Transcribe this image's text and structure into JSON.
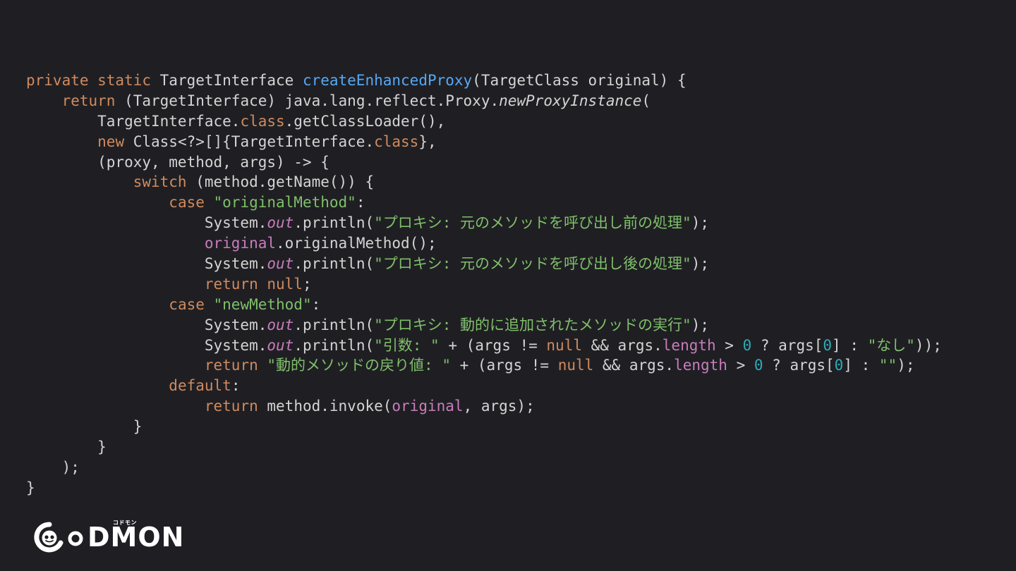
{
  "code": {
    "language": "java",
    "colors": {
      "background": "#1f1f23",
      "plain": "#d4d4d4",
      "keyword": "#d08a5e",
      "method_declaration": "#56a8f5",
      "string": "#7fbf6a",
      "field": "#c77dbb",
      "number": "#2aacb8"
    },
    "lines": [
      [
        [
          "keyword",
          "private static "
        ],
        [
          "plain",
          "TargetInterface "
        ],
        [
          "method-decl",
          "createEnhancedProxy"
        ],
        [
          "plain",
          "(TargetClass original) {"
        ]
      ],
      [
        [
          "plain",
          "    "
        ],
        [
          "keyword",
          "return "
        ],
        [
          "plain",
          "(TargetInterface) java.lang.reflect.Proxy."
        ],
        [
          "italic",
          "newProxyInstance"
        ],
        [
          "plain",
          "("
        ]
      ],
      [
        [
          "plain",
          "        TargetInterface."
        ],
        [
          "keyword",
          "class"
        ],
        [
          "plain",
          ".getClassLoader(),"
        ]
      ],
      [
        [
          "plain",
          "        "
        ],
        [
          "keyword",
          "new "
        ],
        [
          "plain",
          "Class<?>[]{TargetInterface."
        ],
        [
          "keyword",
          "class"
        ],
        [
          "plain",
          "},"
        ]
      ],
      [
        [
          "plain",
          "        (proxy, method, args) -> {"
        ]
      ],
      [
        [
          "plain",
          "            "
        ],
        [
          "keyword",
          "switch "
        ],
        [
          "plain",
          "(method.getName()) {"
        ]
      ],
      [
        [
          "plain",
          "                "
        ],
        [
          "keyword",
          "case "
        ],
        [
          "string",
          "\"originalMethod\""
        ],
        [
          "plain",
          ":"
        ]
      ],
      [
        [
          "plain",
          "                    System."
        ],
        [
          "field",
          "out"
        ],
        [
          "plain",
          ".println("
        ],
        [
          "string",
          "\"プロキシ: 元のメソッドを呼び出し前の処理\""
        ],
        [
          "plain",
          ");"
        ]
      ],
      [
        [
          "plain",
          "                    "
        ],
        [
          "var",
          "original"
        ],
        [
          "plain",
          ".originalMethod();"
        ]
      ],
      [
        [
          "plain",
          "                    System."
        ],
        [
          "field",
          "out"
        ],
        [
          "plain",
          ".println("
        ],
        [
          "string",
          "\"プロキシ: 元のメソッドを呼び出し後の処理\""
        ],
        [
          "plain",
          ");"
        ]
      ],
      [
        [
          "plain",
          "                    "
        ],
        [
          "keyword",
          "return null"
        ],
        [
          "plain",
          ";"
        ]
      ],
      [
        [
          "plain",
          "                "
        ],
        [
          "keyword",
          "case "
        ],
        [
          "string",
          "\"newMethod\""
        ],
        [
          "plain",
          ":"
        ]
      ],
      [
        [
          "plain",
          "                    System."
        ],
        [
          "field",
          "out"
        ],
        [
          "plain",
          ".println("
        ],
        [
          "string",
          "\"プロキシ: 動的に追加されたメソッドの実行\""
        ],
        [
          "plain",
          ");"
        ]
      ],
      [
        [
          "plain",
          "                    System."
        ],
        [
          "field",
          "out"
        ],
        [
          "plain",
          ".println("
        ],
        [
          "string",
          "\"引数: \""
        ],
        [
          "plain",
          " + (args != "
        ],
        [
          "keyword",
          "null"
        ],
        [
          "plain",
          " && args."
        ],
        [
          "var",
          "length"
        ],
        [
          "plain",
          " > "
        ],
        [
          "number",
          "0"
        ],
        [
          "plain",
          " ? args["
        ],
        [
          "number",
          "0"
        ],
        [
          "plain",
          "] : "
        ],
        [
          "string",
          "\"なし\""
        ],
        [
          "plain",
          "));"
        ]
      ],
      [
        [
          "plain",
          "                    "
        ],
        [
          "keyword",
          "return "
        ],
        [
          "string",
          "\"動的メソッドの戻り値: \""
        ],
        [
          "plain",
          " + (args != "
        ],
        [
          "keyword",
          "null"
        ],
        [
          "plain",
          " && args."
        ],
        [
          "var",
          "length"
        ],
        [
          "plain",
          " > "
        ],
        [
          "number",
          "0"
        ],
        [
          "plain",
          " ? args["
        ],
        [
          "number",
          "0"
        ],
        [
          "plain",
          "] : "
        ],
        [
          "string",
          "\"\""
        ],
        [
          "plain",
          ");"
        ]
      ],
      [
        [
          "plain",
          "                "
        ],
        [
          "keyword",
          "default"
        ],
        [
          "plain",
          ":"
        ]
      ],
      [
        [
          "plain",
          "                    "
        ],
        [
          "keyword",
          "return "
        ],
        [
          "plain",
          "method.invoke("
        ],
        [
          "var",
          "original"
        ],
        [
          "plain",
          ", args);"
        ]
      ],
      [
        [
          "plain",
          "            }"
        ]
      ],
      [
        [
          "plain",
          "        }"
        ]
      ],
      [
        [
          "plain",
          "    );"
        ]
      ],
      [
        [
          "plain",
          "}"
        ]
      ]
    ]
  },
  "logo": {
    "text": "DMON",
    "kana": "コドモン",
    "mascot_icon": "codmon-mascot-icon",
    "color": "#ffffff"
  }
}
